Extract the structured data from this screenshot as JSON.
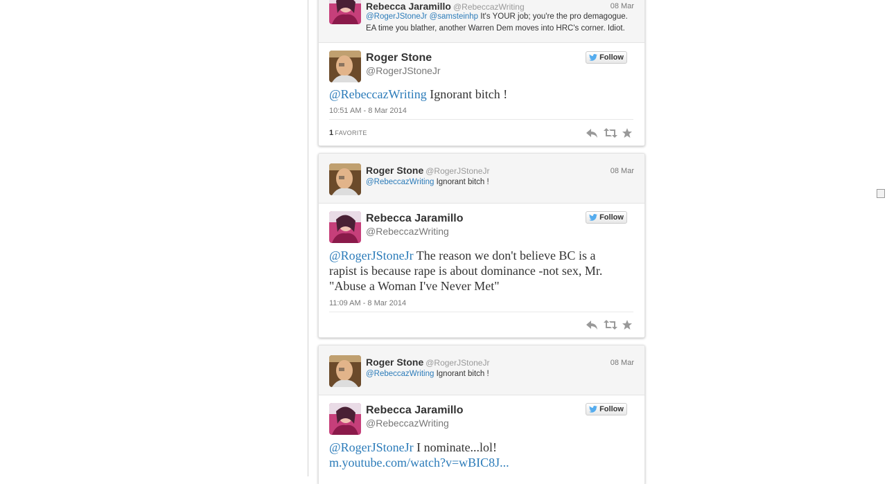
{
  "colors": {
    "link": "#2b7bb9",
    "twitter_blue": "#55acee"
  },
  "follow_label": "Follow",
  "embeds": [
    {
      "parent": {
        "name": "Rebecca Jaramillo",
        "handle": "@RebeccazWriting",
        "date": "08 Mar",
        "mentions": [
          "@RogerJStoneJr",
          "@samsteinhp"
        ],
        "text_line1": "It's YOUR job; you're the pro demagogue.",
        "text_line2": "EA time you blather, another Warren Dem moves into HRC's corner. Idiot."
      },
      "main": {
        "name": "Roger Stone",
        "handle": "@RogerJStoneJr",
        "mention": "@RebeccazWriting",
        "text": "Ignorant bitch !",
        "timestamp": "10:51 AM - 8 Mar 2014",
        "favorites_count": "1",
        "favorites_label": "FAVORITE"
      }
    },
    {
      "parent": {
        "name": "Roger Stone",
        "handle": "@RogerJStoneJr",
        "date": "08 Mar",
        "mention": "@RebeccazWriting",
        "text": "Ignorant bitch !"
      },
      "main": {
        "name": "Rebecca Jaramillo",
        "handle": "@RebeccazWriting",
        "mention": "@RogerJStoneJr",
        "text": "The reason we don't believe BC is a rapist is because rape is about dominance -not sex, Mr. \"Abuse a Woman I've Never Met\"",
        "timestamp": "11:09 AM - 8 Mar 2014"
      }
    },
    {
      "parent": {
        "name": "Roger Stone",
        "handle": "@RogerJStoneJr",
        "date": "08 Mar",
        "mention": "@RebeccazWriting",
        "text": "Ignorant bitch !"
      },
      "main": {
        "name": "Rebecca Jaramillo",
        "handle": "@RebeccazWriting",
        "mention": "@RogerJStoneJr",
        "text": "I nominate...lol!",
        "link": "m.youtube.com/watch?v=wBIC8J..."
      }
    }
  ]
}
